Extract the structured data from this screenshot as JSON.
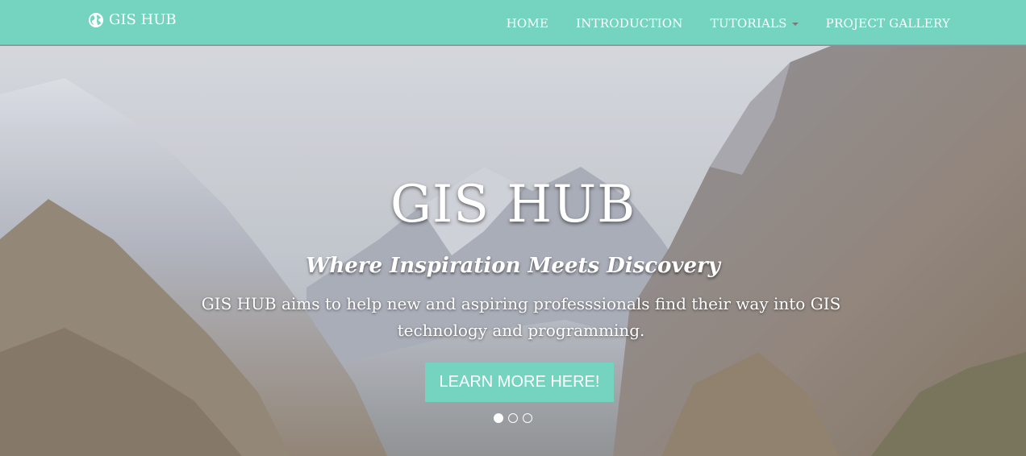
{
  "navbar": {
    "brand": "GIS HUB",
    "brand_icon": "globe-icon",
    "colors": {
      "bar": "#74d4bf",
      "text": "#ffffff"
    },
    "items": [
      {
        "label": "HOME"
      },
      {
        "label": "INTRODUCTION"
      },
      {
        "label": "TUTORIALS",
        "has_dropdown": true
      },
      {
        "label": "PROJECT GALLERY"
      }
    ]
  },
  "hero": {
    "title": "GIS HUB",
    "subtitle": "Where Inspiration Meets Discovery",
    "text": "GIS HUB aims to help new and aspiring professsionals find their way into GIS technology and programming.",
    "button_label": "LEARN MORE HERE!",
    "slides": {
      "count": 3,
      "active_index": 0
    }
  }
}
